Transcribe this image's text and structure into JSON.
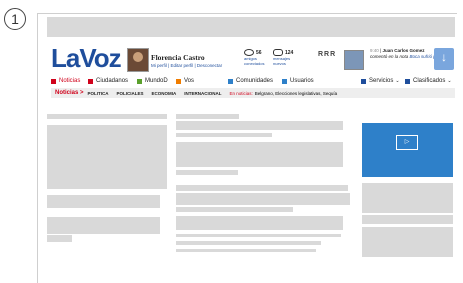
{
  "step_number": "1",
  "header": {
    "logo": "LaVoz",
    "user_name": "Florencia Castro",
    "user_links": [
      "Mi perfil",
      "Editar perfil",
      "Desconectar"
    ],
    "stats": [
      {
        "icon": "people-icon",
        "value": "56",
        "label1": "amigos",
        "label2": "conectados"
      },
      {
        "icon": "mail-icon",
        "value": "124",
        "label1": "mensajes",
        "label2": "nuevos"
      }
    ],
    "reaction_text": "RRR",
    "notification": {
      "time": "9:40",
      "name": "Juan Carlos Gomez",
      "text": "comentó en la nota",
      "link": "Boca sufrió pero llegó"
    },
    "download_icon": "download-arrow-icon"
  },
  "nav": {
    "items": [
      {
        "label": "Noticias",
        "color": "#d0021b"
      },
      {
        "label": "Ciudadanos",
        "color": "#d0021b"
      },
      {
        "label": "MundoD",
        "color": "#5aa02c"
      },
      {
        "label": "Vos",
        "color": "#f07d00"
      },
      {
        "label": "Comunidades",
        "color": "#2e80c9"
      },
      {
        "label": "Usuarios",
        "color": "#2e80c9"
      },
      {
        "label": "Servicios",
        "color": "#1f4e9c"
      },
      {
        "label": "Clasificados",
        "color": "#1f4e9c"
      }
    ]
  },
  "subnav": {
    "section": "Noticias >",
    "items": [
      "POLITICA",
      "POLICIALES",
      "ECONOMIA",
      "INTERNACIONAL"
    ],
    "breaking_label": "En noticias:",
    "breaking_text": "Belgrano, Elecciones legislativas, Sequía"
  },
  "video": {
    "icon": "play-icon"
  },
  "colors": {
    "brand": "#1f4e9c",
    "accent": "#d0021b",
    "video_bg": "#2e80c9",
    "placeholder": "#d9d9d9"
  }
}
